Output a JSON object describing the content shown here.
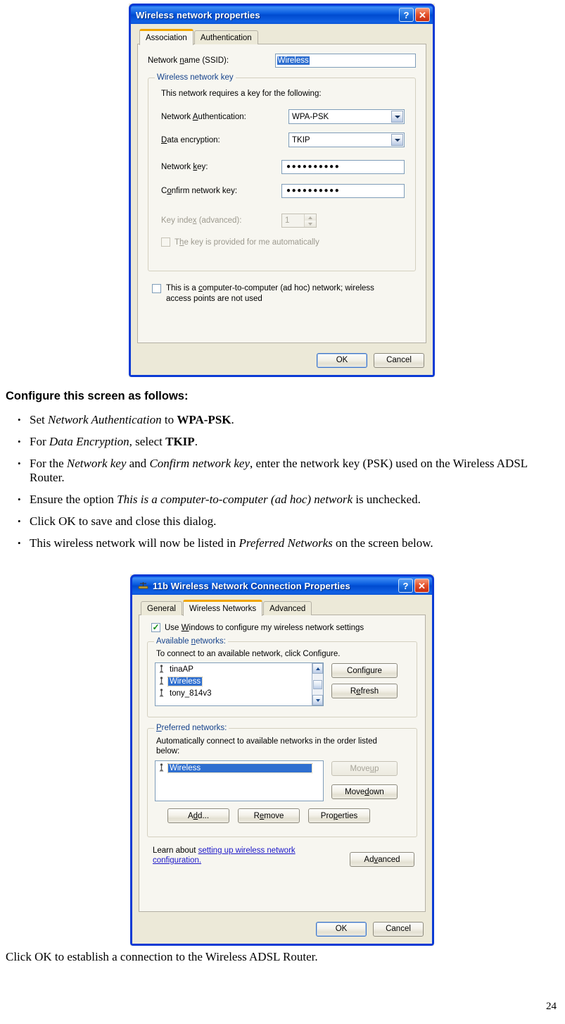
{
  "page": {
    "number": "24",
    "heading": "Configure this screen as follows:",
    "bullets": [
      [
        {
          "t": "Set ",
          "s": "n"
        },
        {
          "t": "Network Authentication",
          "s": "i"
        },
        {
          "t": " to ",
          "s": "n"
        },
        {
          "t": "WPA-PSK",
          "s": "b"
        },
        {
          "t": ".",
          "s": "n"
        }
      ],
      [
        {
          "t": "For ",
          "s": "n"
        },
        {
          "t": "Data Encryption",
          "s": "i"
        },
        {
          "t": ", select ",
          "s": "n"
        },
        {
          "t": "TKIP",
          "s": "b"
        },
        {
          "t": ".",
          "s": "n"
        }
      ],
      [
        {
          "t": "For the ",
          "s": "n"
        },
        {
          "t": "Network key",
          "s": "i"
        },
        {
          "t": " and ",
          "s": "n"
        },
        {
          "t": "Confirm network key",
          "s": "i"
        },
        {
          "t": ", enter the network key (PSK) used on the Wireless ADSL Router.",
          "s": "n"
        }
      ],
      [
        {
          "t": "Ensure the option ",
          "s": "n"
        },
        {
          "t": "This is a computer-to-computer (ad hoc) network",
          "s": "i"
        },
        {
          "t": " is unchecked.",
          "s": "n"
        }
      ],
      [
        {
          "t": "Click OK to save and close this dialog.",
          "s": "n"
        }
      ],
      [
        {
          "t": "This wireless network will now be listed in ",
          "s": "n"
        },
        {
          "t": "Preferred Networks",
          "s": "i"
        },
        {
          "t": " on the screen below.",
          "s": "n"
        }
      ]
    ],
    "footer_line": "Click OK to establish a connection to the Wireless ADSL Router."
  },
  "dialog1": {
    "title": "Wireless network properties",
    "help_label": "?",
    "close_label": "✕",
    "tabs": [
      {
        "label": "Association",
        "active": true
      },
      {
        "label": "Authentication",
        "active": false
      }
    ],
    "ssid_label_a": "Network ",
    "ssid_label_u": "n",
    "ssid_label_b": "ame (SSID):",
    "ssid_value": "Wireless",
    "group_title": "Wireless network key",
    "group_intro": "This network requires a key for the following:",
    "auth_label_a": "Network ",
    "auth_label_u": "A",
    "auth_label_b": "uthentication:",
    "auth_value": "WPA-PSK",
    "enc_label_u": "D",
    "enc_label_b": "ata encryption:",
    "enc_value": "TKIP",
    "netkey_label_a": "Network ",
    "netkey_label_u": "k",
    "netkey_label_b": "ey:",
    "netkey_value": "●●●●●●●●●●",
    "confirm_label_a": "C",
    "confirm_label_u": "o",
    "confirm_label_b": "nfirm network key:",
    "confirm_value": "●●●●●●●●●●",
    "keyindex_label_a": "Key inde",
    "keyindex_label_u": "x",
    "keyindex_label_b": " (advanced):",
    "keyindex_value": "1",
    "autokey_label_a": "T",
    "autokey_label_u": "h",
    "autokey_label_b": "e key is provided for me automatically",
    "adhoc_label_a": "This is a ",
    "adhoc_label_u": "c",
    "adhoc_label_b": "omputer-to-computer (ad hoc) network; wireless",
    "adhoc_label_line2": "access points are not used",
    "ok_label": "OK",
    "cancel_label": "Cancel"
  },
  "dialog2": {
    "title": "11b Wireless Network Connection Properties",
    "help_label": "?",
    "close_label": "✕",
    "tabs": [
      {
        "label": "General",
        "active": false
      },
      {
        "label": "Wireless Networks",
        "active": true
      },
      {
        "label": "Advanced",
        "active": false
      }
    ],
    "usewindows_a": "Use ",
    "usewindows_u": "W",
    "usewindows_b": "indows to configure my wireless network settings",
    "usewindows_checked": true,
    "available": {
      "group_title_a": "Available ",
      "group_title_u": "n",
      "group_title_b": "etworks:",
      "intro": "To connect to an available network, click Configure.",
      "items": [
        {
          "label": "tinaAP",
          "selected": false
        },
        {
          "label": "Wireless",
          "selected": true
        },
        {
          "label": "tony_814v3",
          "selected": false
        }
      ],
      "configure_a": "Confi",
      "configure_u": "g",
      "configure_b": "ure",
      "refresh_a": "R",
      "refresh_u": "e",
      "refresh_b": "fresh"
    },
    "preferred": {
      "group_title_u": "P",
      "group_title_b": "referred networks:",
      "intro_line1": "Automatically connect to available networks in the order listed",
      "intro_line2": "below:",
      "items": [
        {
          "label": "Wireless",
          "selected": true
        }
      ],
      "moveup_a": "Move ",
      "moveup_u": "u",
      "moveup_b": "p",
      "moveup_disabled": true,
      "movedown_a": "Move ",
      "movedown_u": "d",
      "movedown_b": "own",
      "add_a": "A",
      "add_u": "d",
      "add_b": "d...",
      "remove_a": "R",
      "remove_u": "e",
      "remove_b": "move",
      "properties_a": "Pro",
      "properties_u": "p",
      "properties_b": "erties"
    },
    "learn_prefix": "Learn about ",
    "learn_link_line1": "setting up wireless network",
    "learn_link_line2": "configuration.",
    "advanced_a": "Ad",
    "advanced_u": "v",
    "advanced_b": "anced",
    "ok_label": "OK",
    "cancel_label": "Cancel"
  },
  "colors": {
    "title_blue": "#0a4fd0",
    "dialog_face": "#ece9d8",
    "panel_face": "#f7f6f0",
    "selection_blue": "#2f6fd0",
    "group_title": "#15428b",
    "link_blue": "#1a16c8",
    "tab_accent": "#f0a500"
  }
}
